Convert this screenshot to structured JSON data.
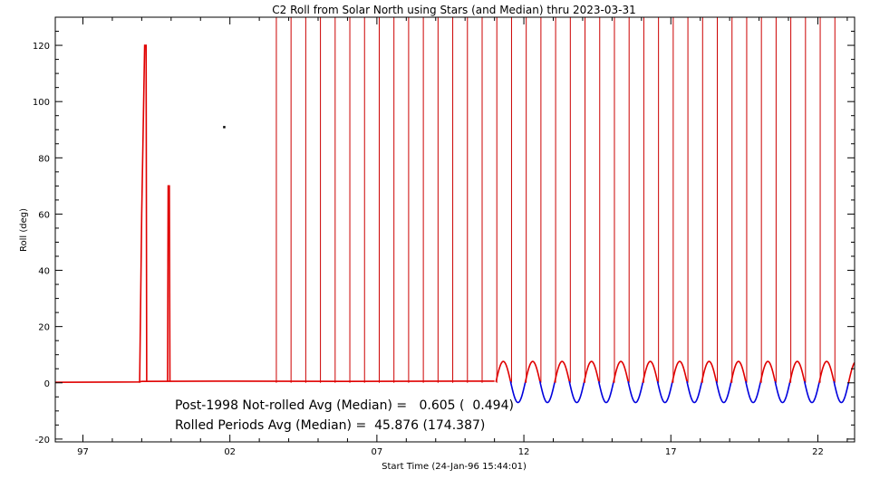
{
  "chart_data": {
    "type": "line",
    "title": "C2 Roll from Solar North using Stars (and Median) thru 2023-03-31",
    "xlabel": "Start Time (24-Jan-96 15:44:01)",
    "ylabel": "Roll (deg)",
    "xlim": [
      1996.06,
      2023.25
    ],
    "ylim": [
      -21,
      130
    ],
    "x_ticks": [
      {
        "value": 1997,
        "label": "97"
      },
      {
        "value": 2002,
        "label": "02"
      },
      {
        "value": 2007,
        "label": "07"
      },
      {
        "value": 2012,
        "label": "12"
      },
      {
        "value": 2017,
        "label": "17"
      },
      {
        "value": 2022,
        "label": "22"
      }
    ],
    "y_ticks": [
      {
        "value": -20,
        "label": "-20"
      },
      {
        "value": 0,
        "label": "0"
      },
      {
        "value": 20,
        "label": "20"
      },
      {
        "value": 40,
        "label": "40"
      },
      {
        "value": 60,
        "label": "60"
      },
      {
        "value": 80,
        "label": "80"
      },
      {
        "value": 100,
        "label": "100"
      },
      {
        "value": 120,
        "label": "120"
      }
    ],
    "grid": false,
    "series": [
      {
        "role": "pre_roll_baseline",
        "color": "#e00000",
        "points": [
          [
            1996.06,
            0.2
          ],
          [
            1998.9,
            0.3
          ],
          [
            1999.0,
            0.5
          ],
          [
            2001.5,
            0.6
          ],
          [
            2006.0,
            0.5
          ],
          [
            2011.0,
            0.6
          ]
        ]
      },
      {
        "role": "spike_1998",
        "color": "#e00000",
        "points": [
          [
            1998.93,
            0
          ],
          [
            1999.0,
            60
          ],
          [
            1999.05,
            90
          ],
          [
            1999.1,
            120
          ],
          [
            1999.15,
            120
          ],
          [
            1999.17,
            0.5
          ]
        ]
      },
      {
        "role": "spike_1999",
        "color": "#e00000",
        "points": [
          [
            1999.88,
            0.5
          ],
          [
            1999.9,
            70
          ],
          [
            1999.94,
            70
          ],
          [
            1999.96,
            0.5
          ]
        ]
      },
      {
        "role": "rolled_oscillation",
        "colors": [
          "#e00000",
          "#0000dd"
        ],
        "start": 2011.05,
        "end": 2023.25,
        "period_years": 1.0,
        "amplitude_deg": 7.3,
        "mean_deg": 0.3
      }
    ],
    "stray_points": [
      [
        2001.8,
        91
      ]
    ],
    "rolled_period_lines": {
      "color": "#cc0000",
      "start": 2003.58,
      "end": 2023.0,
      "spacing_years": 0.5,
      "top_deg": 130
    },
    "annotations": [
      {
        "text": "Post-1998 Not-rolled Avg (Median) =   0.605 (  0.494)",
        "color": "#000000"
      },
      {
        "text": "Rolled Periods Avg (Median) =  45.876 (174.387)",
        "color": "#0000dd"
      }
    ]
  }
}
